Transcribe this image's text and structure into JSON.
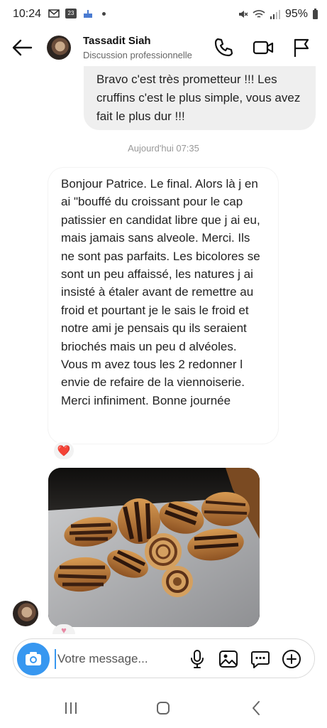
{
  "status_bar": {
    "time": "10:24",
    "battery": "95%",
    "calendar_day": "23"
  },
  "header": {
    "contact_name": "Tassadit Siah",
    "contact_subtitle": "Discussion professionnelle"
  },
  "messages": {
    "outgoing_text": "Bravo c'est très prometteur !!! Les cruffins c'est le plus simple, vous avez fait le plus dur !!!",
    "timestamp": "Aujourd'hui 07:35",
    "incoming_text": "Bonjour Patrice. Le final. Alors là j en ai \"bouffé du croissant pour le cap patissier en candidat libre que j ai eu, mais jamais sans alveole. Merci. Ils ne sont pas parfaits. Les bicolores se sont un peu affaissé, les natures j ai insisté à étaler avant de remettre au froid et pourtant je le sais le froid et notre ami je pensais qu ils seraient briochés mais un peu d alvéoles. Vous m avez tous les 2 redonner l envie de refaire de la viennoiserie. Merci infiniment. Bonne journée",
    "reaction_emoji": "❤️"
  },
  "composer": {
    "placeholder": "Votre message..."
  },
  "icons": {
    "back": "arrow-left-icon",
    "call": "phone-icon",
    "video": "video-camera-icon",
    "flag": "flag-icon",
    "camera": "camera-icon",
    "mic": "microphone-icon",
    "gallery": "image-icon",
    "sticker": "chat-bubble-icon",
    "plus": "plus-circle-icon"
  },
  "colors": {
    "accent": "#3797f0",
    "outgoing_bubble": "#efefef",
    "heart": "#e0245e"
  }
}
